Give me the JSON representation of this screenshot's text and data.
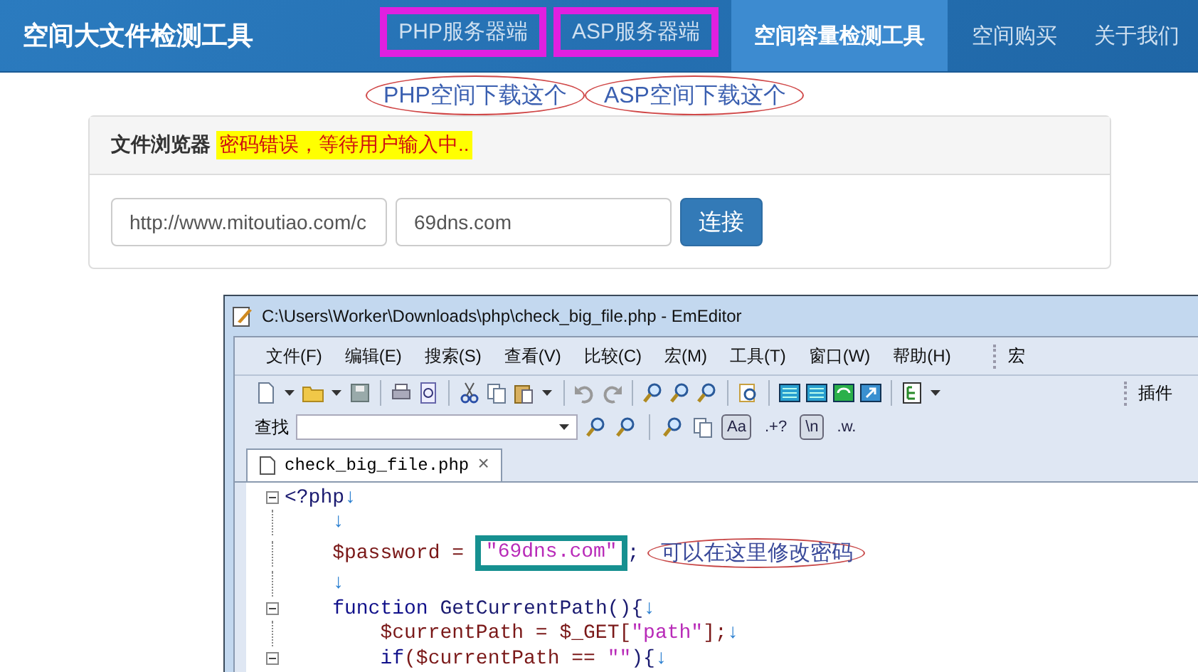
{
  "navbar": {
    "brand": "空间大文件检测工具",
    "items": [
      {
        "label": "PHP服务器端",
        "selected": false,
        "marked": true
      },
      {
        "label": "ASP服务器端",
        "selected": false,
        "marked": true
      },
      {
        "label": "空间容量检测工具",
        "selected": true,
        "marked": false
      },
      {
        "label": "空间购买",
        "selected": false,
        "marked": false
      },
      {
        "label": "关于我们",
        "selected": false,
        "marked": false
      }
    ]
  },
  "download_links": [
    {
      "label": "PHP空间下载这个",
      "circled": true
    },
    {
      "label": "ASP空间下载这个",
      "circled": true
    }
  ],
  "file_browser": {
    "title": "文件浏览器",
    "status": "密码错误，等待用户输入中..",
    "url_field": {
      "value": "http://www.mitoutiao.com/c"
    },
    "password_field": {
      "value": "69dns.com"
    },
    "connect_button": "连接"
  },
  "editor": {
    "title": "C:\\Users\\Worker\\Downloads\\php\\check_big_file.php - EmEditor",
    "menu": [
      "文件(F)",
      "编辑(E)",
      "搜索(S)",
      "查看(V)",
      "比较(C)",
      "宏(M)",
      "工具(T)",
      "窗口(W)",
      "帮助(H)"
    ],
    "macro_label": "宏",
    "plugins_label": "插件",
    "find_label": "查找",
    "find_toggles": [
      {
        "label": "Aa",
        "on": true
      },
      {
        "label": ".+?",
        "on": false
      },
      {
        "label": "\\n",
        "on": true
      },
      {
        "label": ".w.",
        "on": false
      }
    ],
    "tab": {
      "label": "check_big_file.php",
      "close": "×"
    },
    "lines": [
      {
        "fold": true,
        "tokens": [
          {
            "kind": "plain",
            "text": "<?php"
          },
          {
            "kind": "eol",
            "text": "↓"
          }
        ]
      },
      {
        "fold": false,
        "tokens": [
          {
            "kind": "eol",
            "text": "    ↓"
          }
        ]
      },
      {
        "fold": false,
        "tokens": [
          {
            "kind": "var",
            "text": "    $password = "
          },
          {
            "kind": "string",
            "text": "\"69dns.com\"",
            "boxed": true
          },
          {
            "kind": "plain",
            "text": ";"
          }
        ],
        "note": "可以在这里修改密码"
      },
      {
        "fold": false,
        "tokens": [
          {
            "kind": "eol",
            "text": "    ↓"
          }
        ]
      },
      {
        "fold": true,
        "tokens": [
          {
            "kind": "keyword",
            "text": "    function"
          },
          {
            "kind": "plain",
            "text": " GetCurrentPath(){"
          },
          {
            "kind": "eol",
            "text": "↓"
          }
        ]
      },
      {
        "fold": false,
        "tokens": [
          {
            "kind": "var",
            "text": "        $currentPath = $_GET["
          },
          {
            "kind": "string",
            "text": "\"path\""
          },
          {
            "kind": "var",
            "text": "];"
          },
          {
            "kind": "eol",
            "text": "↓"
          }
        ]
      },
      {
        "fold": true,
        "tokens": [
          {
            "kind": "keyword",
            "text": "        if"
          },
          {
            "kind": "var",
            "text": "($currentPath == "
          },
          {
            "kind": "string",
            "text": "\"\""
          },
          {
            "kind": "plain",
            "text": "){"
          },
          {
            "kind": "eol",
            "text": "↓"
          }
        ]
      }
    ]
  }
}
